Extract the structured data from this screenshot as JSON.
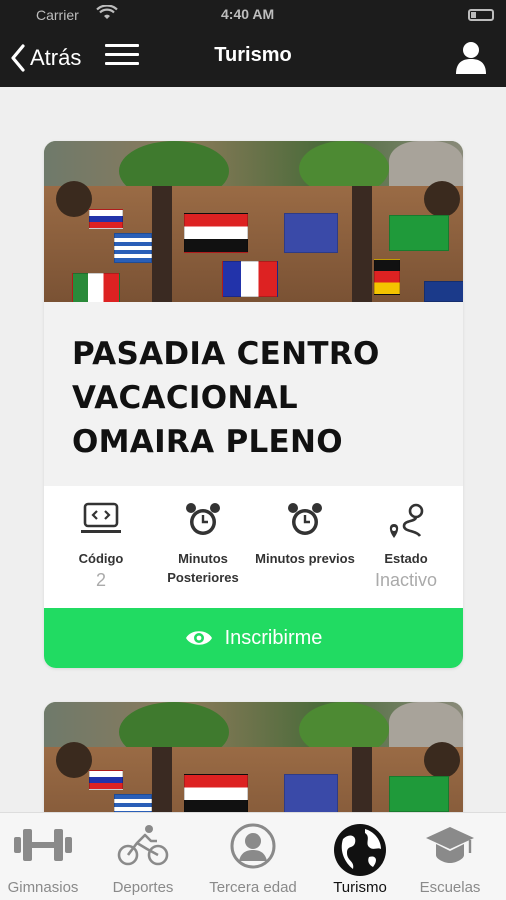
{
  "status": {
    "carrier": "Carrier",
    "time": "4:40 AM"
  },
  "nav": {
    "back_label": "Atrás",
    "title": "Turismo"
  },
  "card": {
    "name": "PASADIA CENTRO VACACIONAL OMAIRA PLENO",
    "stats": [
      {
        "label": "Código",
        "value": "2",
        "icon": "laptop-code-icon"
      },
      {
        "label": "Minutos Posteriores",
        "value": "",
        "icon": "alarm-clock-icon"
      },
      {
        "label": "Minutos previos",
        "value": "",
        "icon": "alarm-clock-icon"
      },
      {
        "label": "Estado",
        "value": "Inactivo",
        "icon": "route-icon"
      }
    ],
    "enroll_label": "Inscribirme",
    "enroll_color": "#21db62"
  },
  "tabs": [
    {
      "label": "Gimnasios",
      "icon": "dumbbell-icon"
    },
    {
      "label": "Deportes",
      "icon": "bicycle-icon"
    },
    {
      "label": "Tercera edad",
      "icon": "user-circle-icon"
    },
    {
      "label": "Turismo",
      "icon": "globe-icon",
      "active": true
    },
    {
      "label": "Escuelas",
      "icon": "graduation-cap-icon"
    }
  ]
}
